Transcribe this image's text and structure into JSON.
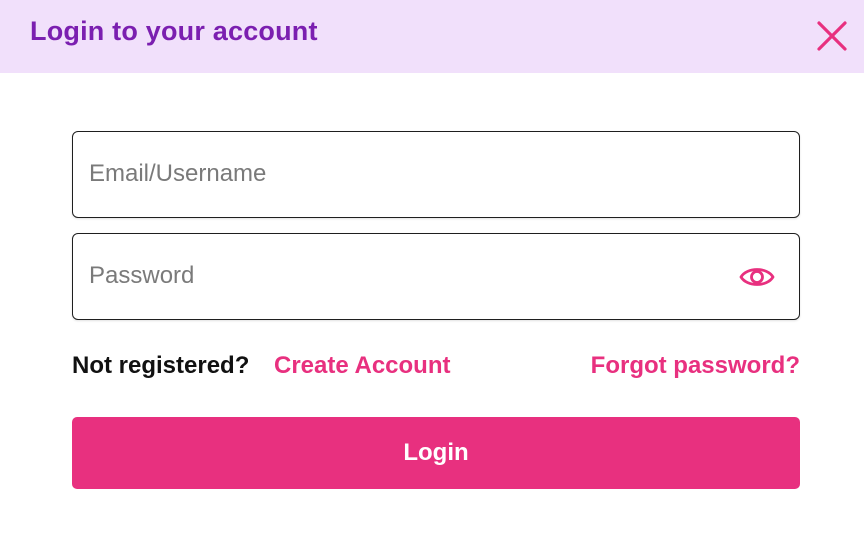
{
  "header": {
    "title": "Login to your account",
    "close_icon": "close-icon"
  },
  "form": {
    "email_placeholder": "Email/Username",
    "email_value": "",
    "password_placeholder": "Password",
    "password_value": "",
    "eye_icon": "eye-icon",
    "not_registered_text": "Not registered?",
    "create_account_label": "Create Account",
    "forgot_password_label": "Forgot password?",
    "login_label": "Login"
  },
  "colors": {
    "header_bg": "#f1e0fb",
    "title": "#7b1fb0",
    "accent": "#e8307f"
  }
}
